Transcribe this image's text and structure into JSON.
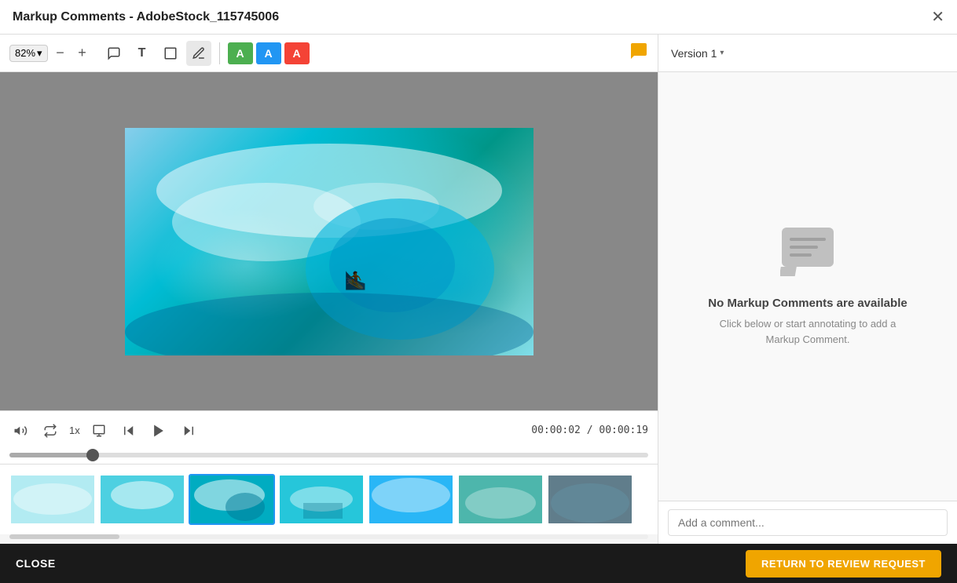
{
  "title_bar": {
    "title": "Markup Comments - AdobeStock_115745006",
    "close_x_label": "✕"
  },
  "toolbar": {
    "zoom_level": "82%",
    "zoom_dropdown_icon": "▾",
    "zoom_out_icon": "−",
    "zoom_in_icon": "+",
    "tools": [
      {
        "id": "comment",
        "icon": "💬",
        "label": "comment-tool"
      },
      {
        "id": "text",
        "icon": "T",
        "label": "text-tool"
      },
      {
        "id": "rect",
        "icon": "☐",
        "label": "rect-tool"
      },
      {
        "id": "draw",
        "icon": "✏",
        "label": "draw-tool"
      }
    ],
    "annotation_buttons": [
      {
        "id": "green-a",
        "label": "A",
        "color": "green"
      },
      {
        "id": "blue-a",
        "label": "A",
        "color": "blue"
      },
      {
        "id": "red-a",
        "label": "A",
        "color": "red"
      }
    ],
    "chat_icon": "💬"
  },
  "video_controls": {
    "volume_icon": "🔊",
    "loop_icon": "↺",
    "speed": "1x",
    "fullscreen_icon": "⛶",
    "skip_back_icon": "⏮",
    "play_icon": "▶",
    "skip_forward_icon": "⏭",
    "current_time": "00:00:02",
    "total_time": "00:00:19",
    "time_separator": " / "
  },
  "right_panel": {
    "version_label": "Version 1",
    "version_dropdown_icon": "▾",
    "no_comments_title": "No Markup Comments are available",
    "no_comments_subtitle": "Click below or start annotating to add a Markup Comment.",
    "comment_placeholder": "Add a comment..."
  },
  "bottom_bar": {
    "close_label": "CLOSE",
    "return_label": "RETURN TO REVIEW REQUEST"
  }
}
